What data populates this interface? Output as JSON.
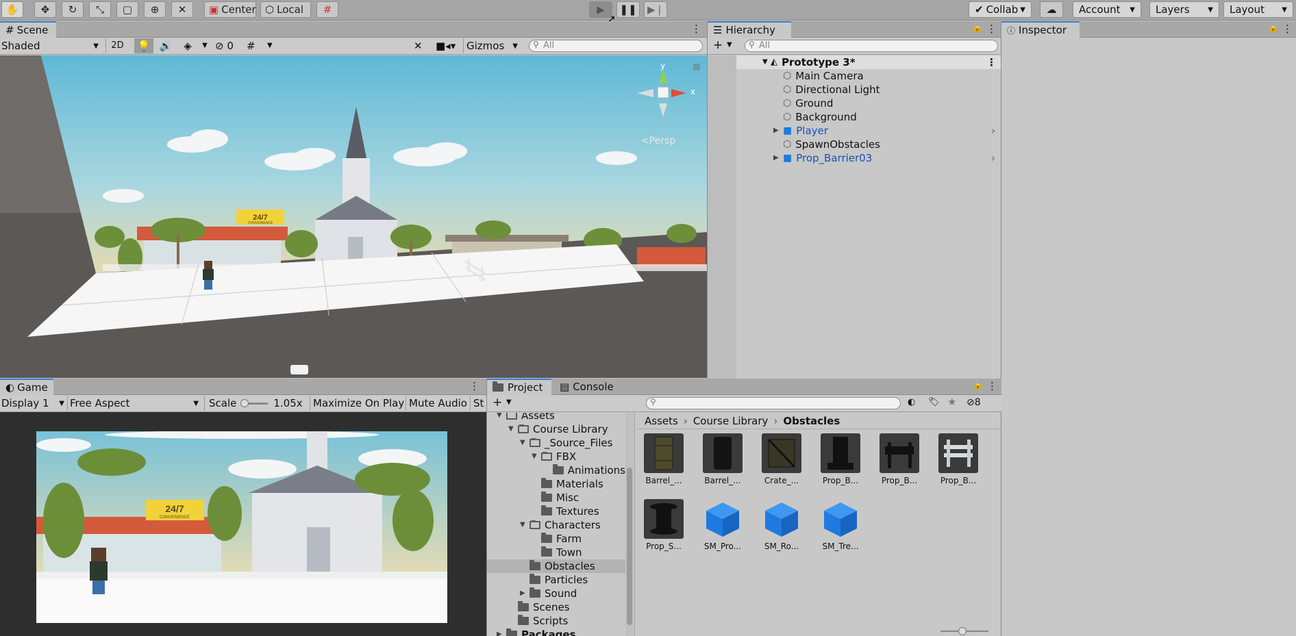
{
  "toolbar": {
    "pivot_label": "Center",
    "space_label": "Local",
    "collab_label": "Collab",
    "account_label": "Account",
    "layers_label": "Layers",
    "layout_label": "Layout"
  },
  "scene": {
    "tab_label": "Scene",
    "shading_mode": "Shaded",
    "mode_2d": "2D",
    "hidden_count": "0",
    "gizmos_label": "Gizmos",
    "search_placeholder": "All",
    "persp_label": "Persp",
    "axis_y": "y",
    "axis_x": "x",
    "sign_24_7": "24/7",
    "sign_convenience": "CONVENIENCE"
  },
  "hierarchy": {
    "tab_label": "Hierarchy",
    "search_placeholder": "All",
    "root": "Prototype 3*",
    "items": [
      {
        "label": "Main Camera",
        "prefab": false,
        "expandable": false
      },
      {
        "label": "Directional Light",
        "prefab": false,
        "expandable": false
      },
      {
        "label": "Ground",
        "prefab": false,
        "expandable": false
      },
      {
        "label": "Background",
        "prefab": false,
        "expandable": false
      },
      {
        "label": "Player",
        "prefab": true,
        "expandable": true
      },
      {
        "label": "SpawnObstacles",
        "prefab": false,
        "expandable": false
      },
      {
        "label": "Prop_Barrier03",
        "prefab": true,
        "expandable": true
      }
    ]
  },
  "inspector": {
    "tab_label": "Inspector"
  },
  "game": {
    "tab_label": "Game",
    "display": "Display 1",
    "aspect": "Free Aspect",
    "scale_label": "Scale",
    "scale_value": "1.05x",
    "maximize_label": "Maximize On Play",
    "mute_label": "Mute Audio",
    "stats_label": "St"
  },
  "project": {
    "tab_label": "Project",
    "console_tab_label": "Console",
    "hidden_count": "8",
    "breadcrumb": [
      "Assets",
      "Course Library",
      "Obstacles"
    ],
    "tree": [
      {
        "label": "Assets",
        "indent": 0,
        "arrow": "down"
      },
      {
        "label": "Course Library",
        "indent": 1,
        "arrow": "down"
      },
      {
        "label": "_Source_Files",
        "indent": 2,
        "arrow": "down"
      },
      {
        "label": "FBX",
        "indent": 3,
        "arrow": "down"
      },
      {
        "label": "Animations",
        "indent": 4,
        "arrow": ""
      },
      {
        "label": "Materials",
        "indent": 3,
        "arrow": ""
      },
      {
        "label": "Misc",
        "indent": 3,
        "arrow": ""
      },
      {
        "label": "Textures",
        "indent": 3,
        "arrow": ""
      },
      {
        "label": "Characters",
        "indent": 2,
        "arrow": "down"
      },
      {
        "label": "Farm",
        "indent": 3,
        "arrow": ""
      },
      {
        "label": "Town",
        "indent": 3,
        "arrow": ""
      },
      {
        "label": "Obstacles",
        "indent": 2,
        "arrow": "",
        "selected": true
      },
      {
        "label": "Particles",
        "indent": 2,
        "arrow": ""
      },
      {
        "label": "Sound",
        "indent": 2,
        "arrow": "right"
      },
      {
        "label": "Scenes",
        "indent": 1,
        "arrow": ""
      },
      {
        "label": "Scripts",
        "indent": 1,
        "arrow": ""
      },
      {
        "label": "Packages",
        "indent": 0,
        "arrow": "right",
        "bold": true
      }
    ],
    "assets": [
      {
        "label": "Barrel_...",
        "kind": "barrel-green"
      },
      {
        "label": "Barrel_...",
        "kind": "barrel-black"
      },
      {
        "label": "Crate_...",
        "kind": "crate"
      },
      {
        "label": "Prop_B...",
        "kind": "block-black"
      },
      {
        "label": "Prop_B...",
        "kind": "barrier-black"
      },
      {
        "label": "Prop_B...",
        "kind": "barrier-grey"
      },
      {
        "label": "Prop_S...",
        "kind": "spool"
      },
      {
        "label": "SM_Pro...",
        "kind": "prefab-cube"
      },
      {
        "label": "SM_Ro...",
        "kind": "prefab-cube"
      },
      {
        "label": "SM_Tre...",
        "kind": "prefab-cube"
      }
    ]
  },
  "colors": {
    "accent": "#3c78d8",
    "prefab_text": "#1a4fb5",
    "prefab_cube": "#1e7ae0"
  }
}
